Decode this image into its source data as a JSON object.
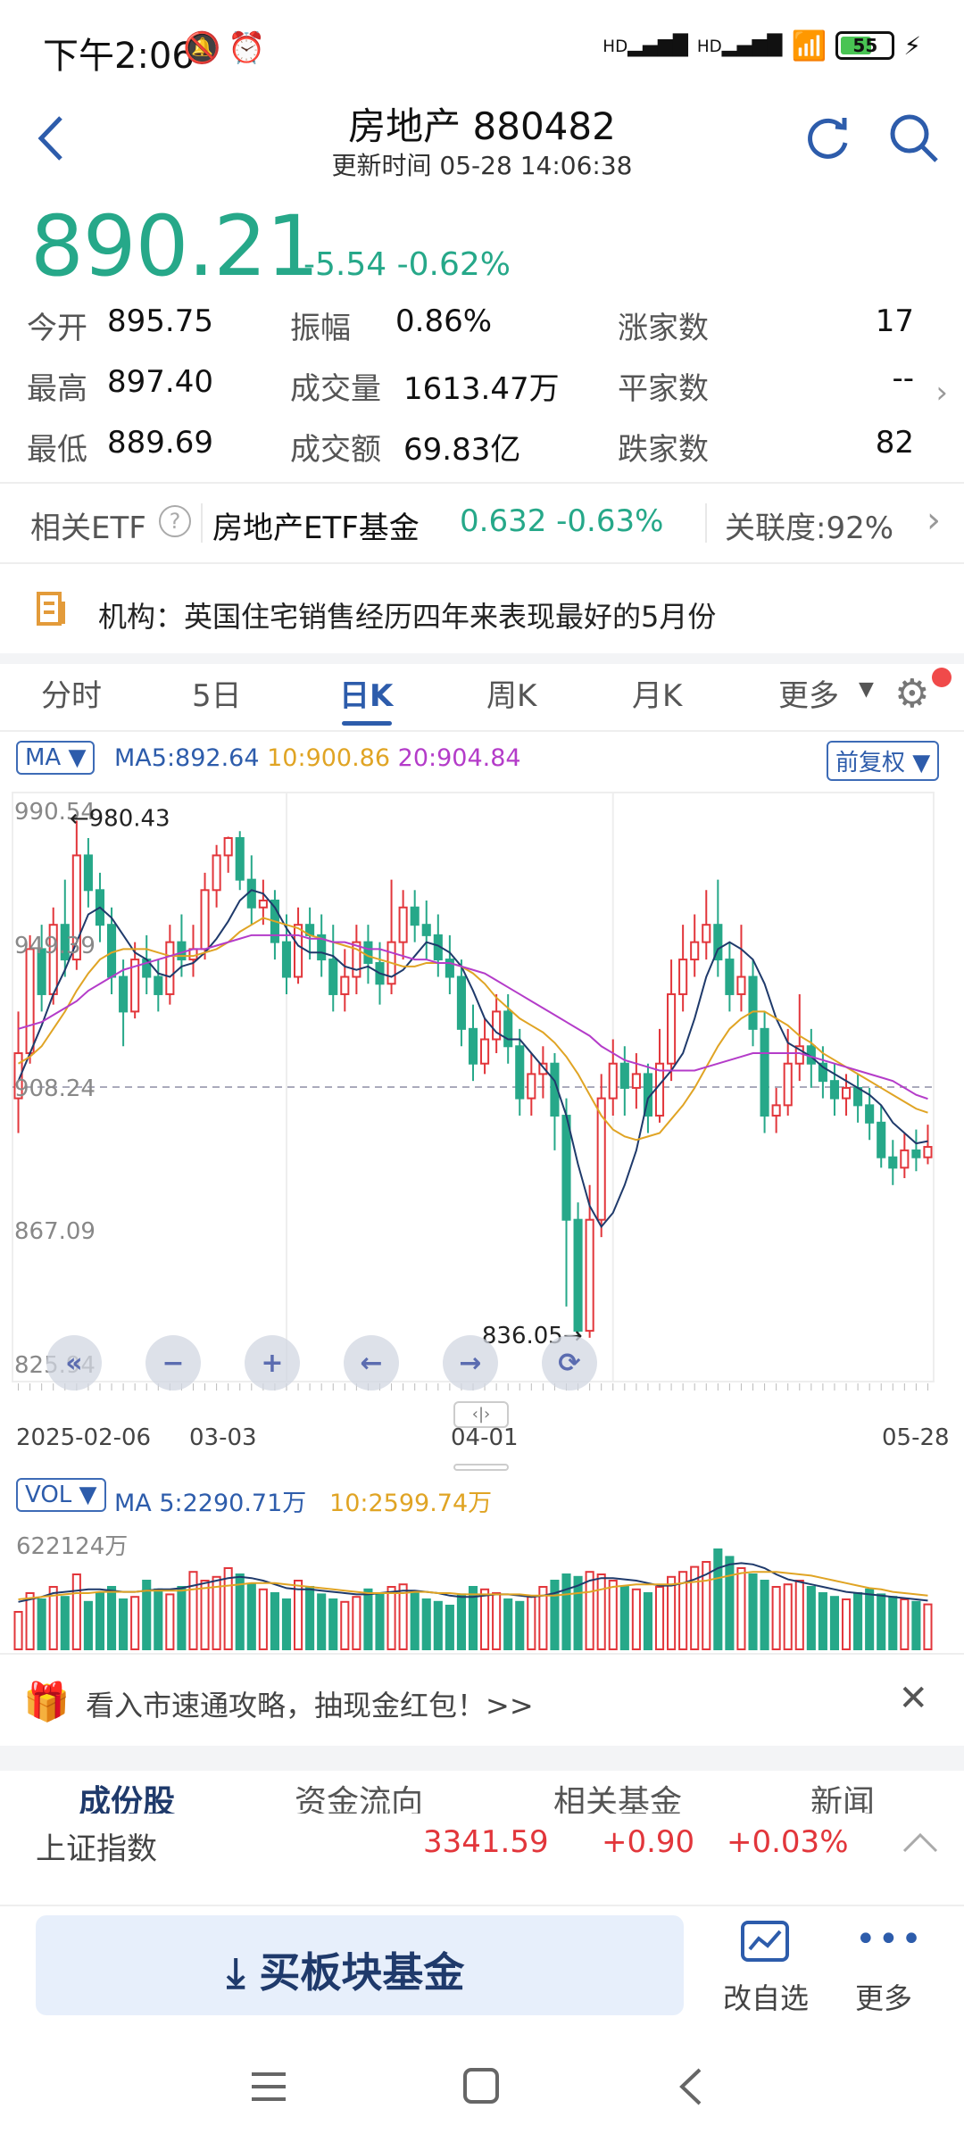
{
  "status_bar": {
    "time": "下午2:06",
    "net1": "HD",
    "net2": "HD",
    "battery": "55"
  },
  "header": {
    "title": "房地产 880482",
    "updated": "更新时间 05-28 14:06:38"
  },
  "quote": {
    "price": "890.21",
    "change": "-5.54",
    "change_pct": "-0.62%",
    "open_label": "今开",
    "open": "895.75",
    "high_label": "最高",
    "high": "897.40",
    "low_label": "最低",
    "low": "889.69",
    "amplitude_label": "振幅",
    "amplitude": "0.86%",
    "volume_label": "成交量",
    "volume": "1613.47万",
    "turnover_label": "成交额",
    "turnover": "69.83亿",
    "up_label": "涨家数",
    "up_count": "17",
    "flat_label": "平家数",
    "flat_count": "--",
    "down_label": "跌家数",
    "down_count": "82"
  },
  "etf": {
    "label": "相关ETF",
    "name": "房地产ETF基金",
    "price": "0.632",
    "pct": "-0.63%",
    "correlation": "关联度:92%"
  },
  "news": {
    "text": "机构：英国住宅销售经历四年来表现最好的5月份"
  },
  "tabs": [
    "分时",
    "5日",
    "日K",
    "周K",
    "月K",
    "更多"
  ],
  "ma_bar": {
    "select": "MA",
    "ma5": "MA5:892.64",
    "ma10": "10:900.86",
    "ma20": "20:904.84",
    "adjust": "前复权"
  },
  "vol_bar": {
    "select": "VOL",
    "ma5": "MA 5:2290.71万",
    "ma10": "10:2599.74万",
    "max": "622124万"
  },
  "chart_data": {
    "type": "candlestick",
    "y_ticks": [
      "990.54",
      "949.39",
      "908.24",
      "867.09",
      "825.94"
    ],
    "ylim": [
      825.94,
      990.54
    ],
    "x_ticks": [
      "2025-02-06",
      "03-03",
      "04-01",
      "05-28"
    ],
    "annot_high": "←980.43",
    "annot_low": "836.05→",
    "reference_line": 908.24,
    "colors": {
      "up": "#e2363b",
      "down": "#26a889",
      "ma5": "#1f3a6b",
      "ma10": "#e0a424",
      "ma20": "#b43cc9"
    },
    "candles": [
      [
        905,
        918,
        895,
        930
      ],
      [
        918,
        948,
        915,
        952
      ],
      [
        948,
        935,
        930,
        955
      ],
      [
        935,
        955,
        932,
        960
      ],
      [
        955,
        945,
        940,
        968
      ],
      [
        945,
        975,
        942,
        985
      ],
      [
        975,
        965,
        960,
        980
      ],
      [
        965,
        955,
        950,
        970
      ],
      [
        955,
        940,
        935,
        960
      ],
      [
        940,
        930,
        920,
        945
      ],
      [
        930,
        945,
        928,
        950
      ],
      [
        945,
        940,
        935,
        952
      ],
      [
        940,
        935,
        930,
        945
      ],
      [
        935,
        950,
        932,
        955
      ],
      [
        950,
        945,
        940,
        958
      ],
      [
        945,
        948,
        940,
        955
      ],
      [
        948,
        965,
        945,
        970
      ],
      [
        965,
        975,
        960,
        978
      ],
      [
        975,
        980,
        970,
        980.4
      ],
      [
        980,
        968,
        965,
        982
      ],
      [
        968,
        960,
        955,
        975
      ],
      [
        960,
        962,
        955,
        968
      ],
      [
        962,
        950,
        945,
        965
      ],
      [
        950,
        940,
        935,
        958
      ],
      [
        940,
        955,
        938,
        960
      ],
      [
        955,
        952,
        945,
        960
      ],
      [
        952,
        945,
        940,
        958
      ],
      [
        945,
        935,
        930,
        955
      ],
      [
        935,
        940,
        930,
        948
      ],
      [
        940,
        950,
        935,
        955
      ],
      [
        950,
        944,
        938,
        955
      ],
      [
        944,
        938,
        932,
        950
      ],
      [
        938,
        950,
        935,
        968
      ],
      [
        950,
        960,
        945,
        965
      ],
      [
        960,
        955,
        950,
        965
      ],
      [
        955,
        952,
        945,
        962
      ],
      [
        952,
        945,
        940,
        958
      ],
      [
        945,
        940,
        935,
        952
      ],
      [
        940,
        925,
        920,
        945
      ],
      [
        925,
        915,
        910,
        932
      ],
      [
        915,
        922,
        912,
        928
      ],
      [
        922,
        930,
        918,
        935
      ],
      [
        930,
        920,
        915,
        935
      ],
      [
        920,
        905,
        900,
        925
      ],
      [
        905,
        912,
        900,
        918
      ],
      [
        912,
        915,
        905,
        920
      ],
      [
        915,
        900,
        890,
        918
      ],
      [
        900,
        870,
        845,
        905
      ],
      [
        870,
        838,
        836.05,
        875
      ],
      [
        838,
        870,
        836,
        880
      ],
      [
        870,
        905,
        865,
        912
      ],
      [
        905,
        915,
        900,
        922
      ],
      [
        915,
        908,
        900,
        920
      ],
      [
        908,
        912,
        902,
        918
      ],
      [
        912,
        900,
        895,
        915
      ],
      [
        900,
        915,
        898,
        925
      ],
      [
        915,
        935,
        910,
        945
      ],
      [
        935,
        945,
        930,
        955
      ],
      [
        945,
        950,
        940,
        958
      ],
      [
        950,
        955,
        945,
        965
      ],
      [
        955,
        945,
        940,
        968
      ],
      [
        945,
        935,
        930,
        950
      ],
      [
        935,
        940,
        930,
        955
      ],
      [
        940,
        925,
        920,
        945
      ],
      [
        925,
        900,
        895,
        930
      ],
      [
        900,
        903,
        895,
        908
      ],
      [
        903,
        915,
        900,
        925
      ],
      [
        915,
        920,
        910,
        935
      ],
      [
        920,
        915,
        908,
        925
      ],
      [
        915,
        910,
        905,
        920
      ],
      [
        910,
        905,
        900,
        915
      ],
      [
        905,
        908,
        900,
        912
      ],
      [
        908,
        903,
        898,
        912
      ],
      [
        903,
        898,
        893,
        908
      ],
      [
        898,
        888,
        885,
        903
      ],
      [
        888,
        885,
        880,
        893
      ],
      [
        885,
        890,
        882,
        895
      ],
      [
        890,
        888,
        884,
        896
      ],
      [
        888,
        891,
        886,
        897.4
      ]
    ],
    "ma5": [
      910,
      918,
      926,
      935,
      942,
      950,
      958,
      960,
      957,
      952,
      947,
      945,
      941,
      940,
      943,
      944,
      947,
      951,
      956,
      962,
      965,
      964,
      960,
      954,
      949,
      947,
      947,
      946,
      943,
      942,
      943,
      941,
      940,
      942,
      946,
      950,
      949,
      947,
      943,
      936,
      928,
      924,
      922,
      922,
      918,
      914,
      910,
      900,
      886,
      874,
      868,
      872,
      880,
      890,
      905,
      909,
      913,
      918,
      928,
      940,
      948,
      950,
      948,
      945,
      938,
      928,
      921,
      919,
      917,
      914,
      912,
      910,
      908,
      906,
      903,
      898,
      895,
      892,
      892.64
    ],
    "ma10": [
      915,
      917,
      920,
      925,
      930,
      936,
      941,
      945,
      947,
      948,
      948,
      948,
      947,
      946,
      946,
      946,
      947,
      948,
      950,
      953,
      955,
      957,
      956,
      955,
      954,
      952,
      951,
      950,
      949,
      948,
      946,
      945,
      944,
      943,
      943,
      944,
      944,
      944,
      943,
      941,
      938,
      934,
      931,
      928,
      926,
      924,
      921,
      917,
      912,
      906,
      900,
      896,
      894,
      893,
      894,
      895,
      899,
      903,
      908,
      914,
      920,
      925,
      928,
      930,
      930,
      928,
      926,
      923,
      921,
      918,
      916,
      914,
      912,
      910,
      908,
      906,
      904,
      902,
      900.86
    ],
    "ma20": [
      925,
      926,
      927,
      929,
      931,
      933,
      936,
      938,
      940,
      942,
      943,
      944,
      945,
      946,
      947,
      948,
      948,
      949,
      950,
      951,
      952,
      952,
      952,
      952,
      952,
      951,
      951,
      950,
      950,
      949,
      948,
      948,
      947,
      946,
      945,
      945,
      944,
      944,
      943,
      942,
      941,
      939,
      937,
      935,
      933,
      931,
      929,
      927,
      925,
      923,
      920,
      918,
      916,
      915,
      914,
      913,
      913,
      913,
      913,
      914,
      915,
      916,
      917,
      918,
      918,
      918,
      918,
      918,
      917,
      916,
      915,
      914,
      913,
      912,
      911,
      910,
      908,
      906,
      904.84
    ],
    "volume": [
      30,
      45,
      40,
      50,
      42,
      60,
      38,
      45,
      50,
      40,
      42,
      55,
      48,
      44,
      50,
      62,
      55,
      58,
      65,
      60,
      52,
      48,
      45,
      40,
      55,
      50,
      44,
      40,
      38,
      42,
      48,
      45,
      50,
      52,
      46,
      40,
      38,
      35,
      44,
      50,
      48,
      45,
      40,
      38,
      42,
      50,
      55,
      60,
      58,
      62,
      60,
      55,
      50,
      48,
      45,
      50,
      58,
      62,
      66,
      70,
      80,
      74,
      65,
      60,
      55,
      50,
      52,
      55,
      50,
      45,
      42,
      40,
      45,
      48,
      44,
      42,
      40,
      38,
      36
    ],
    "vol_ma5": [
      38,
      40,
      42,
      45,
      46,
      47,
      48,
      48,
      47,
      46,
      46,
      47,
      48,
      48,
      49,
      51,
      53,
      55,
      57,
      58,
      57,
      55,
      52,
      49,
      48,
      48,
      47,
      46,
      45,
      44,
      44,
      45,
      46,
      47,
      47,
      46,
      45,
      43,
      42,
      42,
      43,
      44,
      44,
      43,
      42,
      43,
      45,
      48,
      51,
      55,
      57,
      57,
      56,
      55,
      53,
      51,
      51,
      53,
      56,
      60,
      65,
      68,
      69,
      68,
      65,
      60,
      56,
      54,
      52,
      50,
      48,
      46,
      45,
      44,
      43,
      42,
      41,
      40,
      39
    ],
    "vol_ma10": [
      40,
      41,
      42,
      43,
      44,
      45,
      45,
      46,
      46,
      46,
      46,
      47,
      47,
      47,
      47,
      48,
      49,
      50,
      51,
      52,
      53,
      53,
      53,
      52,
      51,
      50,
      49,
      48,
      47,
      46,
      45,
      45,
      45,
      45,
      46,
      46,
      45,
      45,
      44,
      44,
      44,
      44,
      44,
      44,
      43,
      43,
      43,
      44,
      45,
      46,
      48,
      50,
      51,
      52,
      52,
      52,
      52,
      53,
      54,
      55,
      57,
      59,
      61,
      62,
      62,
      62,
      61,
      60,
      59,
      57,
      55,
      53,
      51,
      49,
      48,
      46,
      45,
      44,
      43
    ]
  },
  "promo": {
    "text": "看入市速通攻略，抽现金红包！>>"
  },
  "bottom_tabs": [
    "成份股",
    "资金流向",
    "相关基金",
    "新闻"
  ],
  "index_bar": {
    "name": "上证指数",
    "price": "3341.59",
    "change": "+0.90",
    "pct": "+0.03%"
  },
  "actions": {
    "buy": "买板块基金",
    "watch": "改自选",
    "more": "更多"
  }
}
